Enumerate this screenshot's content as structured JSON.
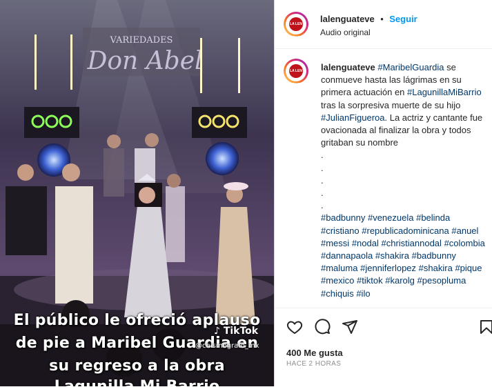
{
  "media": {
    "caption_lines": [
      "El público le ofreció aplauso",
      "de pie a Maribel Guardia en",
      "su regreso a la obra",
      "Lagunilla Mi Barrio"
    ],
    "tiktok_label": "TikTok",
    "tiktok_user": "@chismografo_mx",
    "sign_text": "Don Abel",
    "sign_top": "VARIEDADES"
  },
  "header": {
    "username": "lalenguateve",
    "separator": "•",
    "follow_label": "Seguir",
    "audio": "Audio original",
    "avatar_text": "LA LEN GUA"
  },
  "post": {
    "username": "lalenguateve",
    "segments": [
      {
        "text": "#MaribelGuardia",
        "tag": true
      },
      {
        "text": " se conmueve hasta las lágrimas en su primera actuación en ",
        "tag": false
      },
      {
        "text": "#LagunillaMiBarrio",
        "tag": true
      },
      {
        "text": " tras la sorpresiva muerte de su hijo ",
        "tag": false
      },
      {
        "text": "#JulianFigueroa",
        "tag": true
      },
      {
        "text": ". La actriz y cantante fue ovacionada al finalizar la obra y todos gritaban su nombre",
        "tag": false
      }
    ],
    "dots": [
      ".",
      ".",
      ".",
      ".",
      "."
    ],
    "hashtags": [
      "#badbunny",
      "#venezuela",
      "#belinda",
      "#cristiano",
      "#republicadominicana",
      "#anuel",
      "#messi",
      "#nodal",
      "#christiannodal",
      "#colombia",
      "#dannapaola",
      "#shakira",
      "#badbunny",
      "#maluma",
      "#jenniferlopez",
      "#shakira",
      "#pique",
      "#mexico",
      "#tiktok",
      "#karolg",
      "#pesopluma",
      "#chiquis",
      "#ilo"
    ]
  },
  "actions": {
    "likes": "400 Me gusta",
    "time": "HACE 2 HORAS"
  },
  "colors": {
    "link": "#0095f6",
    "hashtag": "#00376b",
    "secondary_text": "#8e8e8e"
  }
}
